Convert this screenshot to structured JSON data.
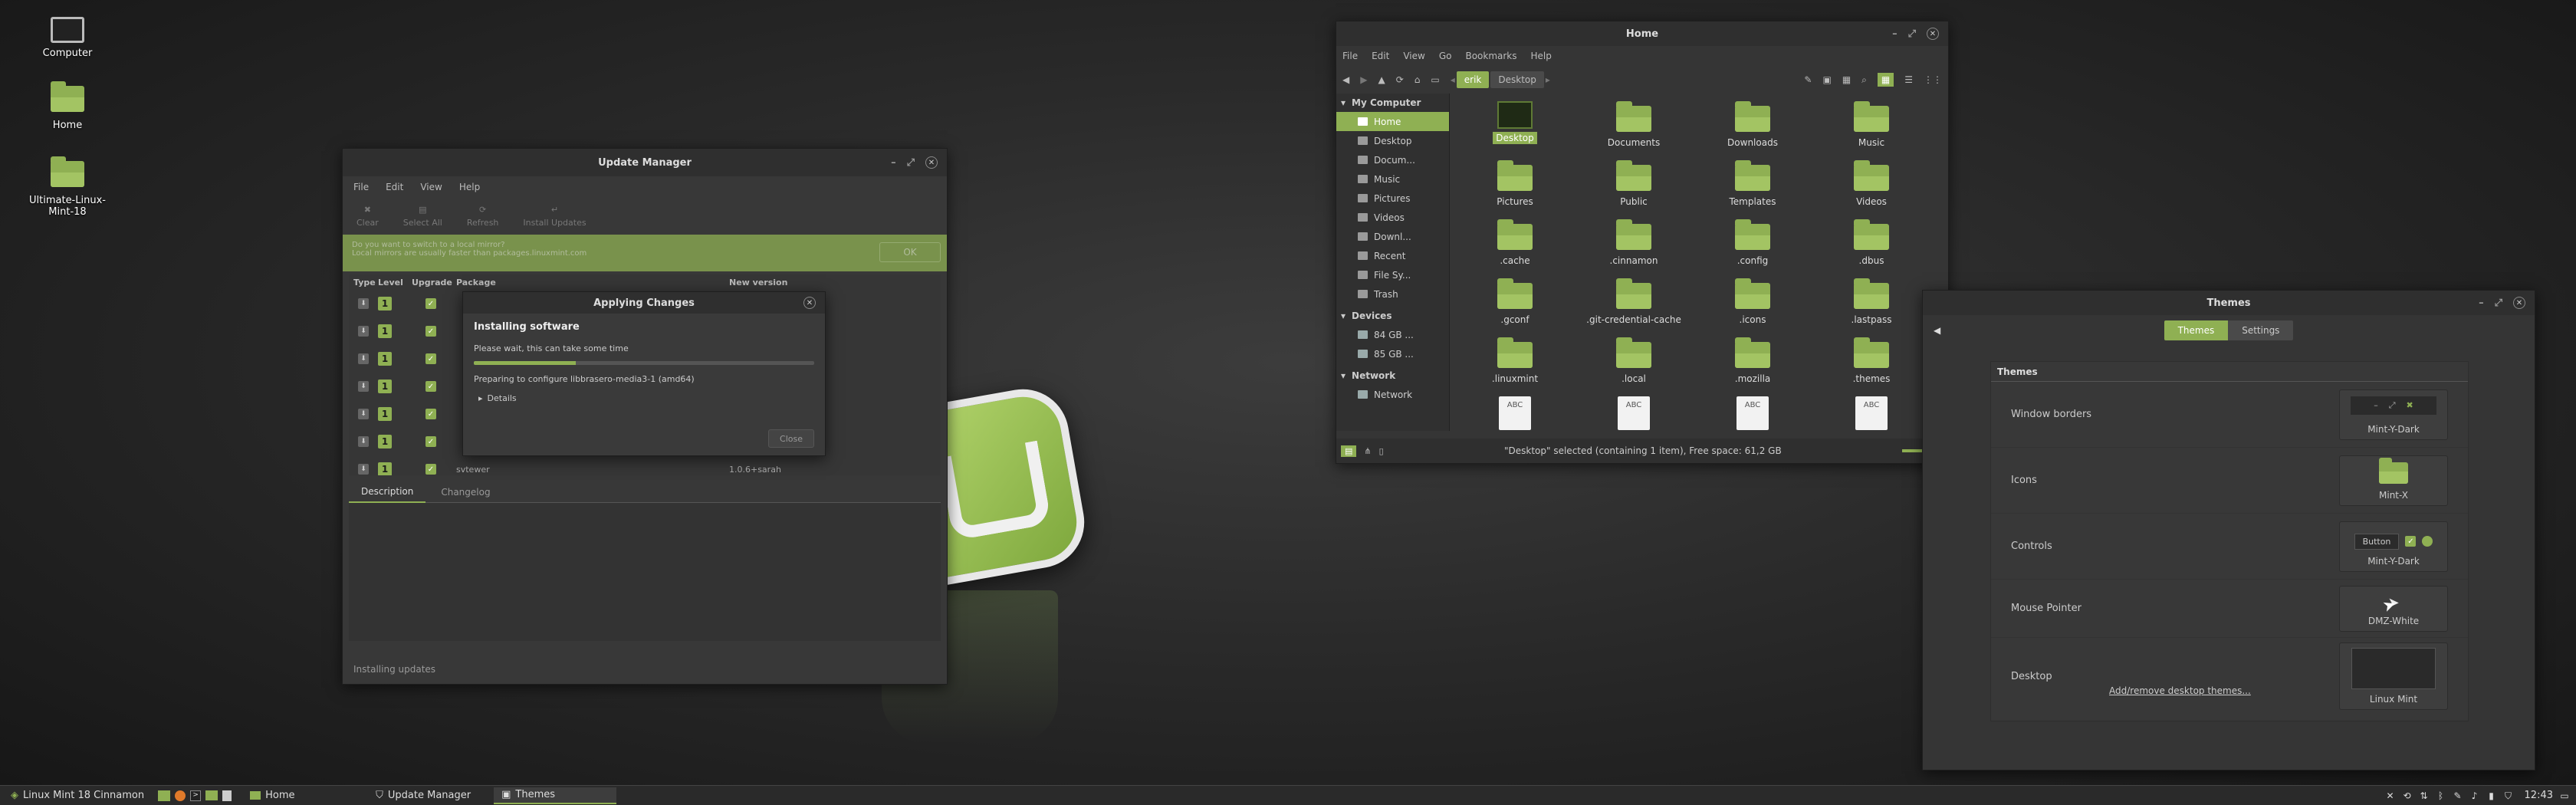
{
  "desktop": {
    "icons": [
      {
        "label": "Computer"
      },
      {
        "label": "Home"
      },
      {
        "label": "Ultimate-Linux-Mint-18"
      }
    ]
  },
  "update_manager": {
    "title": "Update Manager",
    "menu": [
      "File",
      "Edit",
      "View",
      "Help"
    ],
    "toolbar": [
      "Clear",
      "Select All",
      "Refresh",
      "Install Updates"
    ],
    "banner": {
      "line1": "Do you want to switch to a local mirror?",
      "line2": "Local mirrors are usually faster than packages.linuxmint.com",
      "ok": "OK"
    },
    "columns": [
      "Type",
      "Level",
      "Upgrade",
      "Package",
      "New version"
    ],
    "rows": [
      {
        "level": "1",
        "package": "",
        "version": ""
      },
      {
        "level": "1",
        "package": "",
        "version": ""
      },
      {
        "level": "1",
        "package": "",
        "version": ""
      },
      {
        "level": "1",
        "package": "",
        "version": ""
      },
      {
        "level": "1",
        "package": "",
        "version": ""
      },
      {
        "level": "1",
        "package": "",
        "version": ""
      },
      {
        "level": "1",
        "package": "svtewer",
        "version": "1.0.6+sarah"
      }
    ],
    "tabs": [
      "Description",
      "Changelog"
    ],
    "status": "Installing updates"
  },
  "applying": {
    "title": "Applying Changes",
    "heading": "Installing software",
    "subtext": "Please wait, this can take some time",
    "progress": 0.3,
    "step": "Preparing to configure libbrasero-media3-1 (amd64)",
    "details": "Details",
    "close": "Close"
  },
  "files": {
    "title": "Home",
    "menu": [
      "File",
      "Edit",
      "View",
      "Go",
      "Bookmarks",
      "Help"
    ],
    "path": [
      "erik",
      "Desktop"
    ],
    "sidebar": {
      "my_computer": "My Computer",
      "places": [
        "Home",
        "Desktop",
        "Docum...",
        "Music",
        "Pictures",
        "Videos",
        "Downl...",
        "Recent",
        "File Sy...",
        "Trash"
      ],
      "devices": "Devices",
      "device_items": [
        "84 GB ...",
        "85 GB ..."
      ],
      "network": "Network",
      "network_items": [
        "Network"
      ]
    },
    "items": [
      "Desktop",
      "Documents",
      "Downloads",
      "Music",
      "Pictures",
      "Public",
      "Templates",
      "Videos",
      ".cache",
      ".cinnamon",
      ".config",
      ".dbus",
      ".gconf",
      ".git-credential-cache",
      ".icons",
      ".lastpass",
      ".linuxmint",
      ".local",
      ".mozilla",
      ".themes",
      "ABC",
      "ABC",
      "ABC",
      "ABC"
    ],
    "status": "\"Desktop\" selected (containing 1 item), Free space: 61,2 GB"
  },
  "themes": {
    "title": "Themes",
    "tabs": [
      "Themes",
      "Settings"
    ],
    "section": "Themes",
    "rows": [
      {
        "label": "Window borders",
        "value": "Mint-Y-Dark"
      },
      {
        "label": "Icons",
        "value": "Mint-X"
      },
      {
        "label": "Controls",
        "value": "Mint-Y-Dark",
        "button": "Button"
      },
      {
        "label": "Mouse Pointer",
        "value": "DMZ-White"
      },
      {
        "label": "Desktop",
        "value": "Linux Mint"
      }
    ],
    "add_remove": "Add/remove desktop themes..."
  },
  "panel": {
    "menu": "Linux Mint 18 Cinnamon",
    "windows": [
      "Home",
      "Update Manager",
      "Themes"
    ],
    "clock": "12:43"
  }
}
